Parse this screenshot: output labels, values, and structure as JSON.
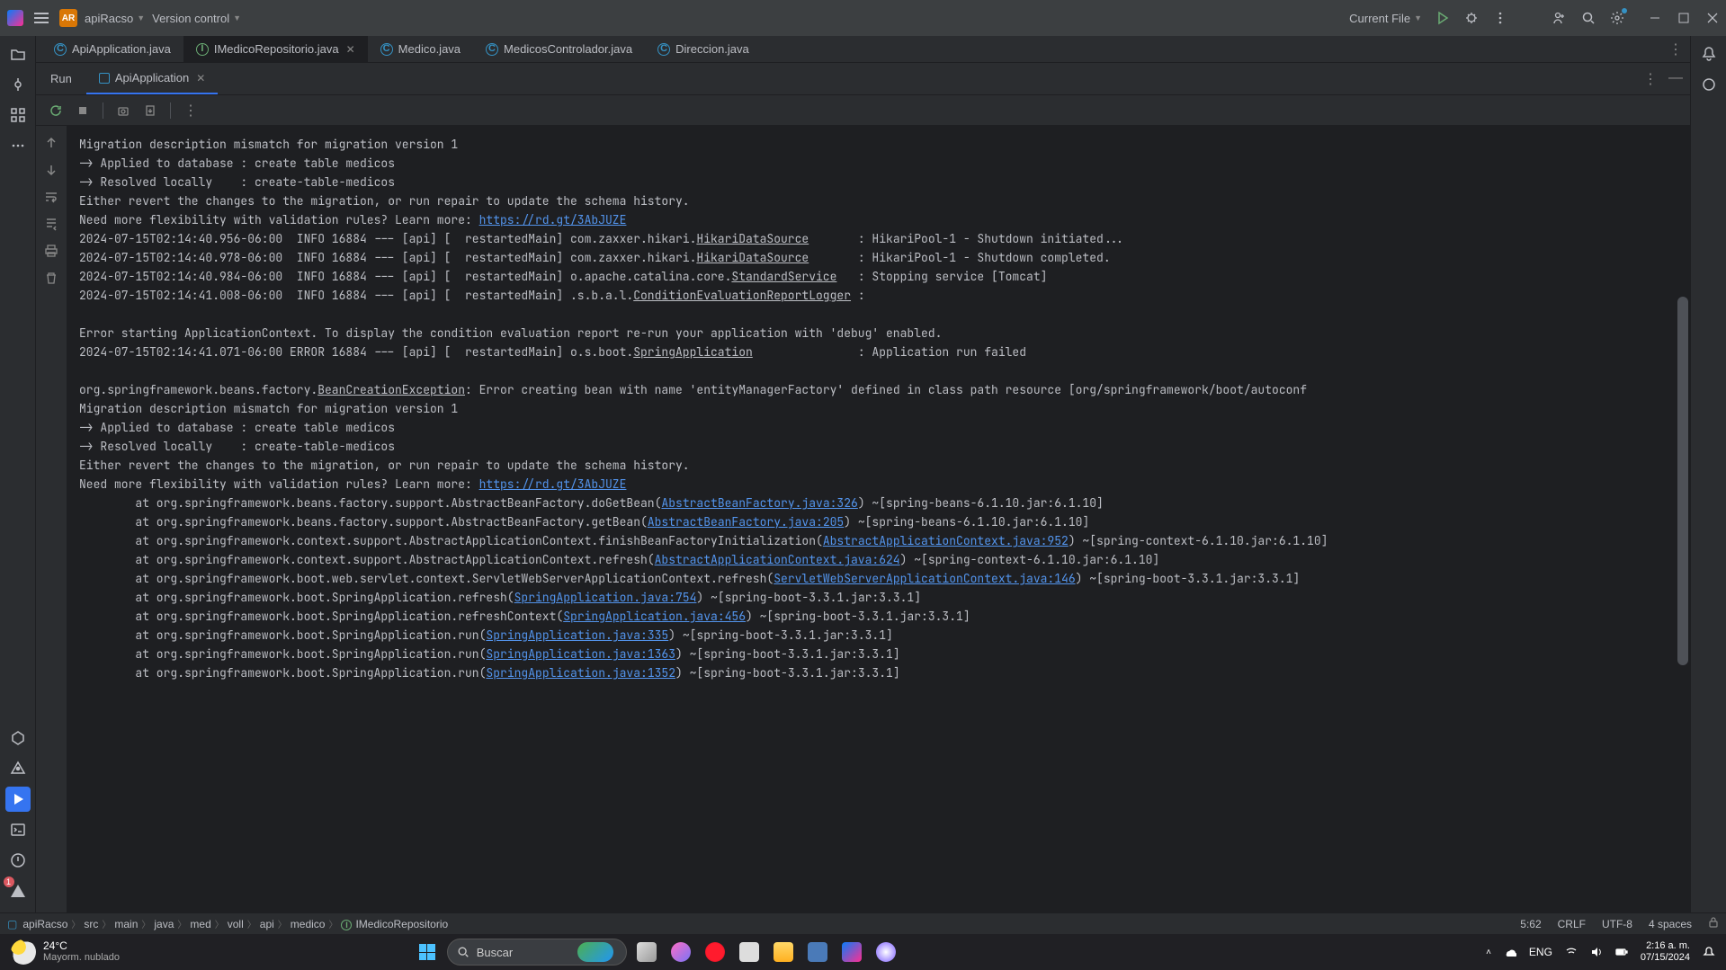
{
  "titlebar": {
    "project_badge": "AR",
    "project_name": "apiRacso",
    "vcs": "Version control",
    "run_config": "Current File"
  },
  "tabs": [
    {
      "name": "ApiApplication.java",
      "icon": "java"
    },
    {
      "name": "IMedicoRepositorio.java",
      "icon": "interface",
      "active": true,
      "closeable": true
    },
    {
      "name": "Medico.java",
      "icon": "java"
    },
    {
      "name": "MedicosControlador.java",
      "icon": "java"
    },
    {
      "name": "Direccion.java",
      "icon": "java"
    }
  ],
  "run": {
    "title": "Run",
    "config": "ApiApplication"
  },
  "breadcrumb": [
    "apiRacso",
    "src",
    "main",
    "java",
    "med",
    "voll",
    "api",
    "medico",
    "IMedicoRepositorio"
  ],
  "status": {
    "pos": "5:62",
    "sep": "CRLF",
    "enc": "UTF-8",
    "indent": "4 spaces"
  },
  "console_lines": [
    {
      "t": "Migration description mismatch for migration version 1"
    },
    {
      "t": "-> Applied to database : create table medicos"
    },
    {
      "t": "-> Resolved locally    : create-table-medicos"
    },
    {
      "t": "Either revert the changes to the migration, or run repair to update the schema history."
    },
    {
      "seg": [
        {
          "t": "Need more flexibility with validation rules? Learn more: "
        },
        {
          "t": "https://rd.gt/3AbJUZE",
          "link": true
        }
      ]
    },
    {
      "seg": [
        {
          "t": "2024-07-15T02:14:40.956-06:00  INFO 16884 --- [api] [  restartedMain] com.zaxxer.hikari."
        },
        {
          "t": "HikariDataSource",
          "cls": true
        },
        {
          "t": "       : HikariPool-1 - Shutdown initiated..."
        }
      ]
    },
    {
      "seg": [
        {
          "t": "2024-07-15T02:14:40.978-06:00  INFO 16884 --- [api] [  restartedMain] com.zaxxer.hikari."
        },
        {
          "t": "HikariDataSource",
          "cls": true
        },
        {
          "t": "       : HikariPool-1 - Shutdown completed."
        }
      ]
    },
    {
      "seg": [
        {
          "t": "2024-07-15T02:14:40.984-06:00  INFO 16884 --- [api] [  restartedMain] o.apache.catalina.core."
        },
        {
          "t": "StandardService",
          "cls": true
        },
        {
          "t": "   : Stopping service [Tomcat]"
        }
      ]
    },
    {
      "seg": [
        {
          "t": "2024-07-15T02:14:41.008-06:00  INFO 16884 --- [api] [  restartedMain] .s.b.a.l."
        },
        {
          "t": "ConditionEvaluationReportLogger",
          "cls": true
        },
        {
          "t": " : "
        }
      ]
    },
    {
      "t": ""
    },
    {
      "t": "Error starting ApplicationContext. To display the condition evaluation report re-run your application with 'debug' enabled."
    },
    {
      "seg": [
        {
          "t": "2024-07-15T02:14:41.071-06:00 ERROR 16884 --- [api] [  restartedMain] o.s.boot."
        },
        {
          "t": "SpringApplication",
          "cls": true
        },
        {
          "t": "               : Application run failed"
        }
      ]
    },
    {
      "t": ""
    },
    {
      "seg": [
        {
          "t": "org.springframework.beans.factory."
        },
        {
          "t": "BeanCreationException",
          "cls": true
        },
        {
          "t": ": Error creating bean with name 'entityManagerFactory' defined in class path resource [org/springframework/boot/autoconf"
        }
      ]
    },
    {
      "t": "Migration description mismatch for migration version 1"
    },
    {
      "t": "-> Applied to database : create table medicos"
    },
    {
      "t": "-> Resolved locally    : create-table-medicos"
    },
    {
      "t": "Either revert the changes to the migration, or run repair to update the schema history."
    },
    {
      "seg": [
        {
          "t": "Need more flexibility with validation rules? Learn more: "
        },
        {
          "t": "https://rd.gt/3AbJUZE",
          "link": true
        }
      ]
    },
    {
      "seg": [
        {
          "t": "\tat org.springframework.beans.factory.support.AbstractBeanFactory.doGetBean("
        },
        {
          "t": "AbstractBeanFactory.java:326",
          "link": true
        },
        {
          "t": ") ~[spring-beans-6.1.10.jar:6.1.10]"
        }
      ]
    },
    {
      "seg": [
        {
          "t": "\tat org.springframework.beans.factory.support.AbstractBeanFactory.getBean("
        },
        {
          "t": "AbstractBeanFactory.java:205",
          "link": true
        },
        {
          "t": ") ~[spring-beans-6.1.10.jar:6.1.10]"
        }
      ]
    },
    {
      "seg": [
        {
          "t": "\tat org.springframework.context.support.AbstractApplicationContext.finishBeanFactoryInitialization("
        },
        {
          "t": "AbstractApplicationContext.java:952",
          "link": true
        },
        {
          "t": ") ~[spring-context-6.1.10.jar:6.1.10]"
        }
      ]
    },
    {
      "seg": [
        {
          "t": "\tat org.springframework.context.support.AbstractApplicationContext.refresh("
        },
        {
          "t": "AbstractApplicationContext.java:624",
          "link": true
        },
        {
          "t": ") ~[spring-context-6.1.10.jar:6.1.10]"
        }
      ]
    },
    {
      "seg": [
        {
          "t": "\tat org.springframework.boot.web.servlet.context.ServletWebServerApplicationContext.refresh("
        },
        {
          "t": "ServletWebServerApplicationContext.java:146",
          "link": true
        },
        {
          "t": ") ~[spring-boot-3.3.1.jar:3.3.1]"
        }
      ]
    },
    {
      "seg": [
        {
          "t": "\tat org.springframework.boot.SpringApplication.refresh("
        },
        {
          "t": "SpringApplication.java:754",
          "link": true
        },
        {
          "t": ") ~[spring-boot-3.3.1.jar:3.3.1]"
        }
      ]
    },
    {
      "seg": [
        {
          "t": "\tat org.springframework.boot.SpringApplication.refreshContext("
        },
        {
          "t": "SpringApplication.java:456",
          "link": true
        },
        {
          "t": ") ~[spring-boot-3.3.1.jar:3.3.1]"
        }
      ]
    },
    {
      "seg": [
        {
          "t": "\tat org.springframework.boot.SpringApplication.run("
        },
        {
          "t": "SpringApplication.java:335",
          "link": true
        },
        {
          "t": ") ~[spring-boot-3.3.1.jar:3.3.1]"
        }
      ]
    },
    {
      "seg": [
        {
          "t": "\tat org.springframework.boot.SpringApplication.run("
        },
        {
          "t": "SpringApplication.java:1363",
          "link": true
        },
        {
          "t": ") ~[spring-boot-3.3.1.jar:3.3.1]"
        }
      ]
    },
    {
      "seg": [
        {
          "t": "\tat org.springframework.boot.SpringApplication.run("
        },
        {
          "t": "SpringApplication.java:1352",
          "link": true
        },
        {
          "t": ") ~[spring-boot-3.3.1.jar:3.3.1]"
        }
      ]
    }
  ],
  "taskbar": {
    "temp": "24°C",
    "weather": "Mayorm. nublado",
    "search": "Buscar",
    "lang": "ENG",
    "time": "2:16 a. m.",
    "date": "07/15/2024"
  }
}
